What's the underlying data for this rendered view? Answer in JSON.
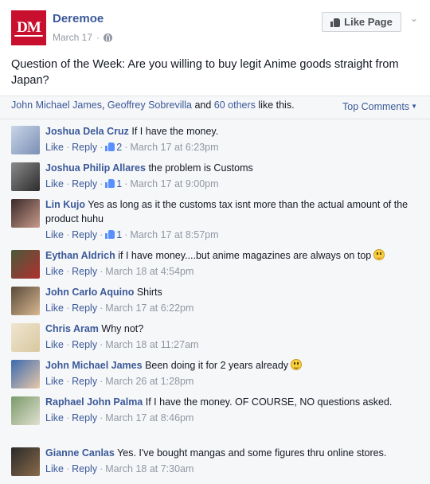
{
  "post": {
    "page_name": "Deremoe",
    "logo_text": "DM",
    "date": "March 17",
    "separator": "·",
    "like_page_label": "Like Page",
    "text": "Question of the Week: Are you willing to buy legit Anime goods straight from Japan?"
  },
  "likes": {
    "name1": "John Michael James",
    "comma": ", ",
    "name2": "Geoffrey Sobrevilla",
    "and": " and ",
    "others": "60 others",
    "suffix": " like this.",
    "top_comments": "Top Comments"
  },
  "action_labels": {
    "like": "Like",
    "reply": "Reply",
    "dot": "·"
  },
  "comments": [
    {
      "name": "Joshua Dela Cruz",
      "text": "If I have the money.",
      "likes": "2",
      "time": "March 17 at 6:23pm",
      "avatar_colors": [
        "#c9d6e8",
        "#7a8fb5"
      ]
    },
    {
      "name": "Joshua Philip Allares",
      "text": "the problem is Customs",
      "likes": "1",
      "time": "March 17 at 9:00pm",
      "avatar_colors": [
        "#8a8a8a",
        "#2c2c2c"
      ]
    },
    {
      "name": "Lin Kujo",
      "text": "Yes as long as it the customs tax isnt more than the actual amount of the product huhu",
      "likes": "1",
      "time": "March 17 at 8:57pm",
      "avatar_colors": [
        "#3a2a2a",
        "#c89a8a"
      ]
    },
    {
      "name": "Eythan Aldrich",
      "text": "if I have money....but anime magazines are always on top",
      "likes": "",
      "time": "March 18 at 4:54pm",
      "avatar_colors": [
        "#4a5a3a",
        "#b03030"
      ],
      "emoticon": "tongue-emoticon-icon"
    },
    {
      "name": "John Carlo Aquino",
      "text": "Shirts",
      "likes": "",
      "time": "March 17 at 6:22pm",
      "avatar_colors": [
        "#5a4a3a",
        "#d8b890"
      ]
    },
    {
      "name": "Chris Aram",
      "text": "Why not?",
      "likes": "",
      "time": "March 18 at 11:27am",
      "avatar_colors": [
        "#f0e6d0",
        "#d8c8a0"
      ]
    },
    {
      "name": "John Michael James",
      "text": "Been doing it for 2 years already",
      "likes": "",
      "time": "March 26 at 1:28pm",
      "avatar_colors": [
        "#3a6ab0",
        "#e8c8a8"
      ],
      "emoticon": "smile-emoticon-icon"
    },
    {
      "name": "Raphael John Palma",
      "text": "If I have the money. OF COURSE, NO questions asked.",
      "likes": "",
      "time": "March 17 at 8:46pm",
      "avatar_colors": [
        "#7a9a6a",
        "#e0e0d0"
      ]
    },
    {
      "name": "Gianne Canlas",
      "text": "Yes. I've bought mangas and some figures thru online stores.",
      "likes": "",
      "time": "March 18 at 7:30am",
      "avatar_colors": [
        "#2a2a2a",
        "#8a6a4a"
      ]
    }
  ],
  "colors": {
    "link": "#3b5998",
    "meta": "#9197a3",
    "brand": "#c8102e",
    "bar_bg": "#f6f7f9"
  }
}
